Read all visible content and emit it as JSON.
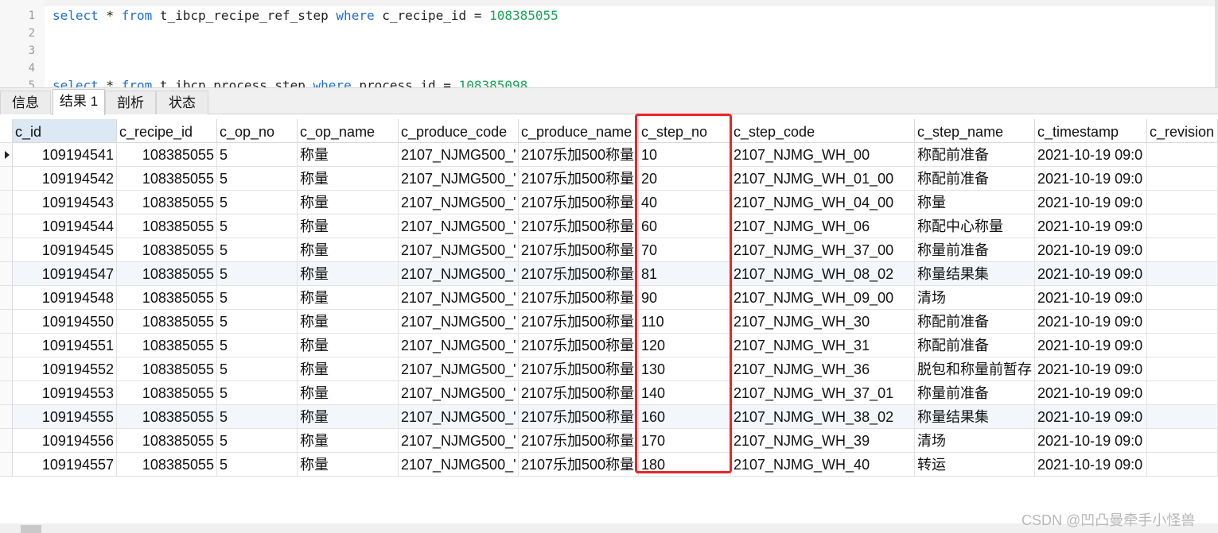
{
  "editor": {
    "lines": [
      {
        "no": "1",
        "tokens": [
          {
            "t": "select",
            "c": "kw"
          },
          {
            "t": " * ",
            "c": ""
          },
          {
            "t": "from",
            "c": "kw"
          },
          {
            "t": " t_ibcp_recipe_ref_step ",
            "c": ""
          },
          {
            "t": "where",
            "c": "kw"
          },
          {
            "t": " c_recipe_id = ",
            "c": ""
          },
          {
            "t": "108385055",
            "c": "num"
          }
        ]
      },
      {
        "no": "2",
        "tokens": []
      },
      {
        "no": "3",
        "tokens": []
      },
      {
        "no": "4",
        "tokens": []
      },
      {
        "no": "5",
        "tokens": [
          {
            "t": "select",
            "c": "kw"
          },
          {
            "t": " * ",
            "c": ""
          },
          {
            "t": "from",
            "c": "kw"
          },
          {
            "t": " t_ibcp_process_step ",
            "c": ""
          },
          {
            "t": "where",
            "c": "kw"
          },
          {
            "t": " process_id = ",
            "c": ""
          },
          {
            "t": "108385098",
            "c": "num"
          }
        ]
      }
    ]
  },
  "tabs": [
    {
      "label": "信息",
      "active": false
    },
    {
      "label": "结果 1",
      "active": true
    },
    {
      "label": "剖析",
      "active": false
    },
    {
      "label": "状态",
      "active": false
    }
  ],
  "grid": {
    "columns": [
      "c_id",
      "c_recipe_id",
      "c_op_no",
      "c_op_name",
      "c_produce_code",
      "c_produce_name",
      "c_step_no",
      "c_step_code",
      "c_step_name",
      "c_timestamp",
      "c_revision"
    ],
    "rows": [
      [
        "109194541",
        "108385055",
        "5",
        "称量",
        "2107_NJMG500_'",
        "2107乐加500称量",
        "10",
        "2107_NJMG_WH_00",
        "称配前准备",
        "2021-10-19 09:0",
        ""
      ],
      [
        "109194542",
        "108385055",
        "5",
        "称量",
        "2107_NJMG500_'",
        "2107乐加500称量",
        "20",
        "2107_NJMG_WH_01_00",
        "称配前准备",
        "2021-10-19 09:0",
        ""
      ],
      [
        "109194543",
        "108385055",
        "5",
        "称量",
        "2107_NJMG500_'",
        "2107乐加500称量",
        "40",
        "2107_NJMG_WH_04_00",
        "称量",
        "2021-10-19 09:0",
        ""
      ],
      [
        "109194544",
        "108385055",
        "5",
        "称量",
        "2107_NJMG500_'",
        "2107乐加500称量",
        "60",
        "2107_NJMG_WH_06",
        "称配中心称量",
        "2021-10-19 09:0",
        ""
      ],
      [
        "109194545",
        "108385055",
        "5",
        "称量",
        "2107_NJMG500_'",
        "2107乐加500称量",
        "70",
        "2107_NJMG_WH_37_00",
        "称量前准备",
        "2021-10-19 09:0",
        ""
      ],
      [
        "109194547",
        "108385055",
        "5",
        "称量",
        "2107_NJMG500_'",
        "2107乐加500称量",
        "81",
        "2107_NJMG_WH_08_02",
        "称量结果集",
        "2021-10-19 09:0",
        ""
      ],
      [
        "109194548",
        "108385055",
        "5",
        "称量",
        "2107_NJMG500_'",
        "2107乐加500称量",
        "90",
        "2107_NJMG_WH_09_00",
        "清场",
        "2021-10-19 09:0",
        ""
      ],
      [
        "109194550",
        "108385055",
        "5",
        "称量",
        "2107_NJMG500_'",
        "2107乐加500称量",
        "110",
        "2107_NJMG_WH_30",
        "称配前准备",
        "2021-10-19 09:0",
        ""
      ],
      [
        "109194551",
        "108385055",
        "5",
        "称量",
        "2107_NJMG500_'",
        "2107乐加500称量",
        "120",
        "2107_NJMG_WH_31",
        "称配前准备",
        "2021-10-19 09:0",
        ""
      ],
      [
        "109194552",
        "108385055",
        "5",
        "称量",
        "2107_NJMG500_'",
        "2107乐加500称量",
        "130",
        "2107_NJMG_WH_36",
        "脱包和称量前暂存",
        "2021-10-19 09:0",
        ""
      ],
      [
        "109194553",
        "108385055",
        "5",
        "称量",
        "2107_NJMG500_'",
        "2107乐加500称量",
        "140",
        "2107_NJMG_WH_37_01",
        "称量前准备",
        "2021-10-19 09:0",
        ""
      ],
      [
        "109194555",
        "108385055",
        "5",
        "称量",
        "2107_NJMG500_'",
        "2107乐加500称量",
        "160",
        "2107_NJMG_WH_38_02",
        "称量结果集",
        "2021-10-19 09:0",
        ""
      ],
      [
        "109194556",
        "108385055",
        "5",
        "称量",
        "2107_NJMG500_'",
        "2107乐加500称量",
        "170",
        "2107_NJMG_WH_39",
        "清场",
        "2021-10-19 09:0",
        ""
      ],
      [
        "109194557",
        "108385055",
        "5",
        "称量",
        "2107_NJMG500_'",
        "2107乐加500称量",
        "180",
        "2107_NJMG_WH_40",
        "转运",
        "2021-10-19 09:0",
        ""
      ]
    ],
    "selected_column": "c_id",
    "highlighted_column": "c_step_no",
    "highlight_color": "#e8262b"
  },
  "watermark": "CSDN @凹凸曼牵手小怪兽"
}
